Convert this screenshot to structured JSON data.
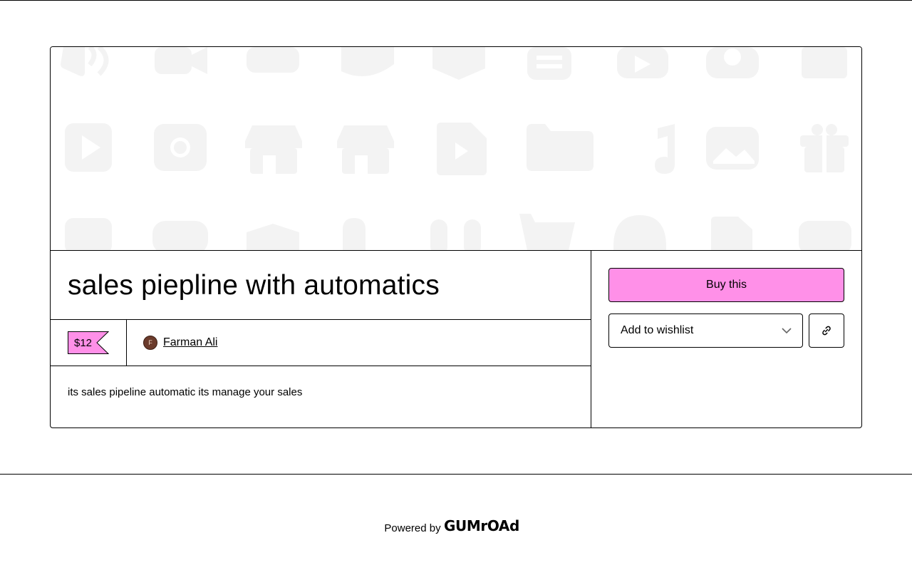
{
  "product": {
    "title": "sales piepline with automatics",
    "price": "$12",
    "creator": {
      "name": "Farman Ali",
      "avatar_initial": "F"
    },
    "description": "its sales pipeline automatic its manage your sales"
  },
  "actions": {
    "buy_label": "Buy this",
    "wishlist_label": "Add to wishlist"
  },
  "footer": {
    "powered_by": "Powered by",
    "brand": "Gumroad"
  },
  "colors": {
    "accent_pink": "#ff90e8",
    "border": "#000000",
    "cover_icon": "#f4f4f4"
  }
}
